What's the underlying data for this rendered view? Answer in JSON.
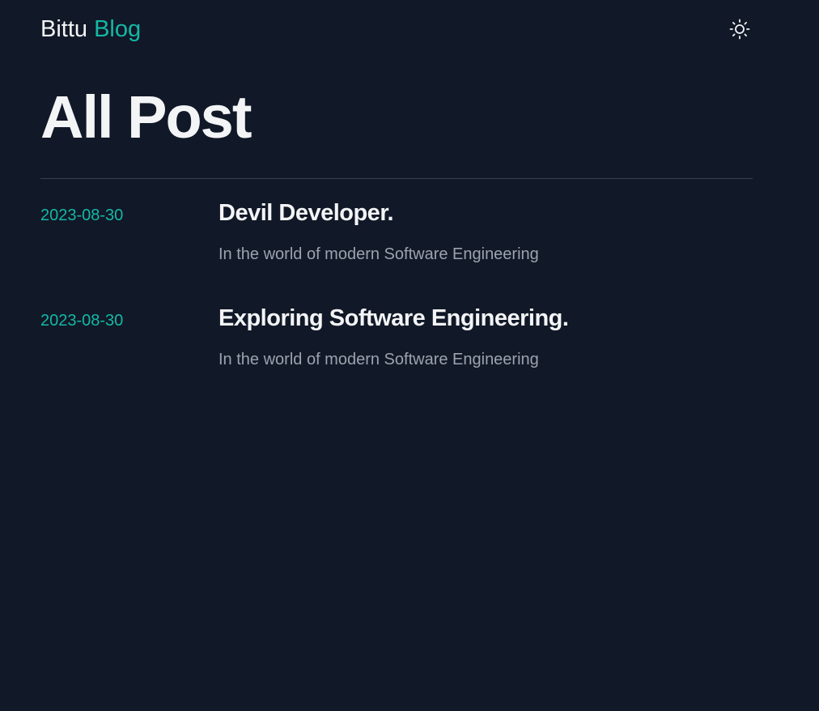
{
  "header": {
    "brand_primary": "Bittu",
    "brand_accent": "Blog",
    "theme_toggle_icon": "sun-icon"
  },
  "main": {
    "title": "All Post",
    "posts": [
      {
        "date": "2023-08-30",
        "title": "Devil Developer.",
        "summary": "In the world of modern Software Engineering"
      },
      {
        "date": "2023-08-30",
        "title": "Exploring Software Engineering.",
        "summary": "In the world of modern Software Engineering"
      }
    ]
  },
  "colors": {
    "background": "#111827",
    "accent": "#14b8a6",
    "text_primary": "#f3f4f6",
    "text_muted": "#9ca3af",
    "divider": "#374151"
  }
}
